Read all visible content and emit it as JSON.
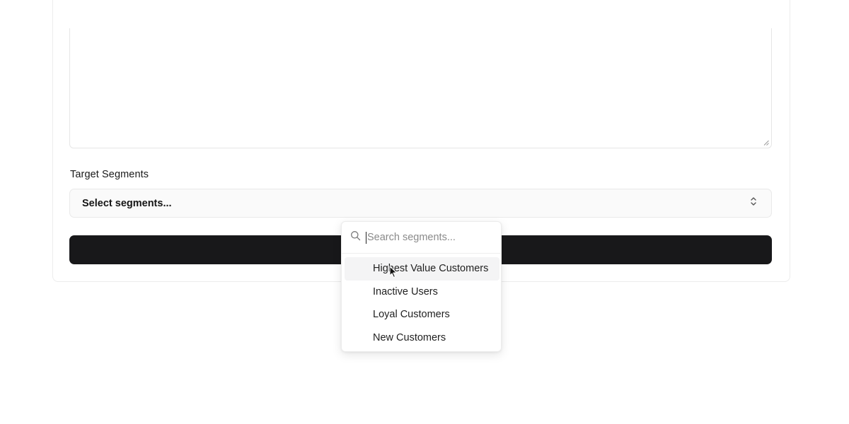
{
  "form": {
    "segments_label": "Target Segments",
    "segments_select_value": "Select segments..."
  },
  "dropdown": {
    "search_placeholder": "Search segments...",
    "options": [
      {
        "label": "Highest Value Customers",
        "highlighted": true
      },
      {
        "label": "Inactive Users",
        "highlighted": false
      },
      {
        "label": "Loyal Customers",
        "highlighted": false
      },
      {
        "label": "New Customers",
        "highlighted": false
      }
    ]
  },
  "colors": {
    "submit_button": "#18181a",
    "highlight": "#f4f4f5"
  },
  "icons": {
    "search": "search-icon",
    "chevrons": "chevrons-up-down-icon",
    "resize": "resize-handle-icon",
    "cursor": "mouse-pointer-icon"
  }
}
